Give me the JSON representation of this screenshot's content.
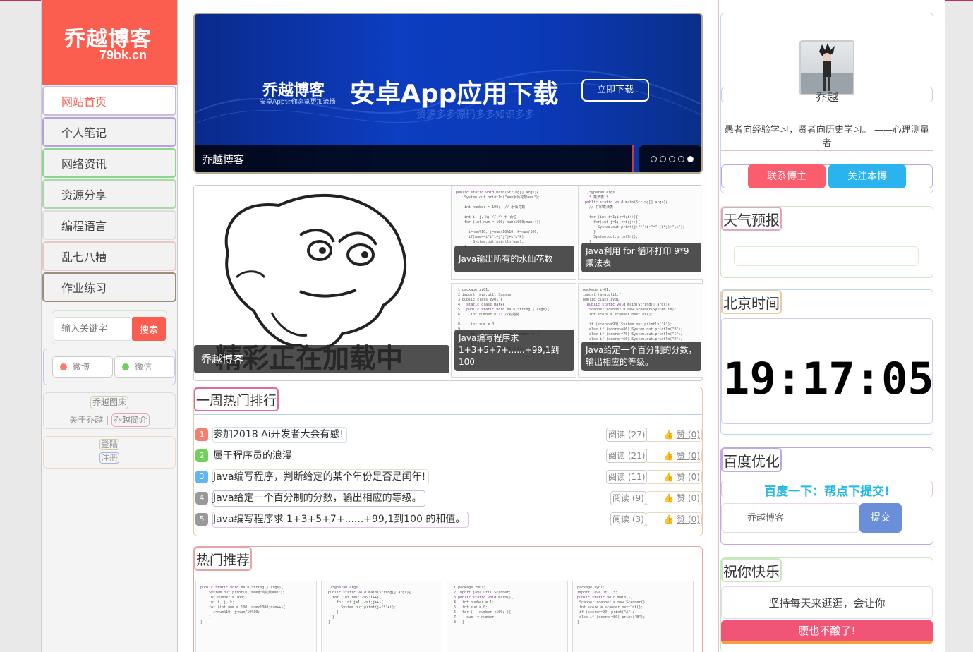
{
  "sidebar": {
    "site_title": "乔越博客",
    "site_domain": "79bk.cn",
    "nav": [
      "网站首页",
      "个人笔记",
      "网络资讯",
      "资源分享",
      "编程语言",
      "乱七八糟",
      "作业练习"
    ],
    "search_placeholder": "输入关键字",
    "search_button": "搜索",
    "weibo": "微博",
    "weixin": "微信",
    "gallery_link": "乔越图床",
    "about_label": "关于乔越",
    "about_link": "乔越简介",
    "login": "登陆",
    "register": "注册"
  },
  "banner": {
    "brand": "乔越博客",
    "brand_sub": "安卓App让你浏览更加流畅",
    "headline": "安卓App应用下载",
    "tagline": "资源多多源码多多知识多多",
    "button": "立即下载",
    "caption": "乔越博客",
    "slide_count": 5,
    "active_slide": 5
  },
  "featured": {
    "big_caption": "乔越博客",
    "loading_text": "精彩正在加载中",
    "cells": [
      "Java输出所有的水仙花数",
      "Java利用 for 循环打印 9*9 乘法表",
      "Java编写程序求 1+3+5+7+......+99,1到100",
      "Java给定一个百分制的分数，输出相应的等级。"
    ]
  },
  "weekly": {
    "title": "一周热门排行",
    "colors": [
      "#f97d6e",
      "#6fd15b",
      "#5fb7f2",
      "#999999",
      "#999999"
    ],
    "items": [
      {
        "num": "1",
        "title": "参加2018 Ai开发者大会有感!",
        "reads": "阅读 (27)",
        "likes": "赞 (0)"
      },
      {
        "num": "2",
        "title": "属于程序员的浪漫",
        "reads": "阅读 (21)",
        "likes": "赞 (0)"
      },
      {
        "num": "3",
        "title": "Java编写程序，判断给定的某个年份是否是闰年!",
        "reads": "阅读 (11)",
        "likes": "赞 (0)"
      },
      {
        "num": "4",
        "title": "Java给定一个百分制的分数，输出相应的等级。",
        "reads": "阅读 (9)",
        "likes": "赞 (0)"
      },
      {
        "num": "5",
        "title": "Java编写程序求 1+3+5+7+......+99,1到100 的和值。",
        "reads": "阅读 (3)",
        "likes": "赞 (0)"
      }
    ]
  },
  "hot": {
    "title": "热门推荐"
  },
  "profile": {
    "name": "乔越",
    "motto": "愚者向经验学习，贤者向历史学习。 ——心理测量者",
    "contact_button": "联系博主",
    "follow_button": "关注本博"
  },
  "weather": {
    "title": "天气预报"
  },
  "clock": {
    "title": "北京时间",
    "time": "19:17:05"
  },
  "seo": {
    "title": "百度优化",
    "headline": "百度一下：帮点下提交!",
    "input_value": "乔越博客",
    "submit": "提交"
  },
  "greeting": {
    "title": "祝你快乐",
    "line1": "坚持每天来逛逛，会让你",
    "line2": "腰也不酸了!"
  }
}
